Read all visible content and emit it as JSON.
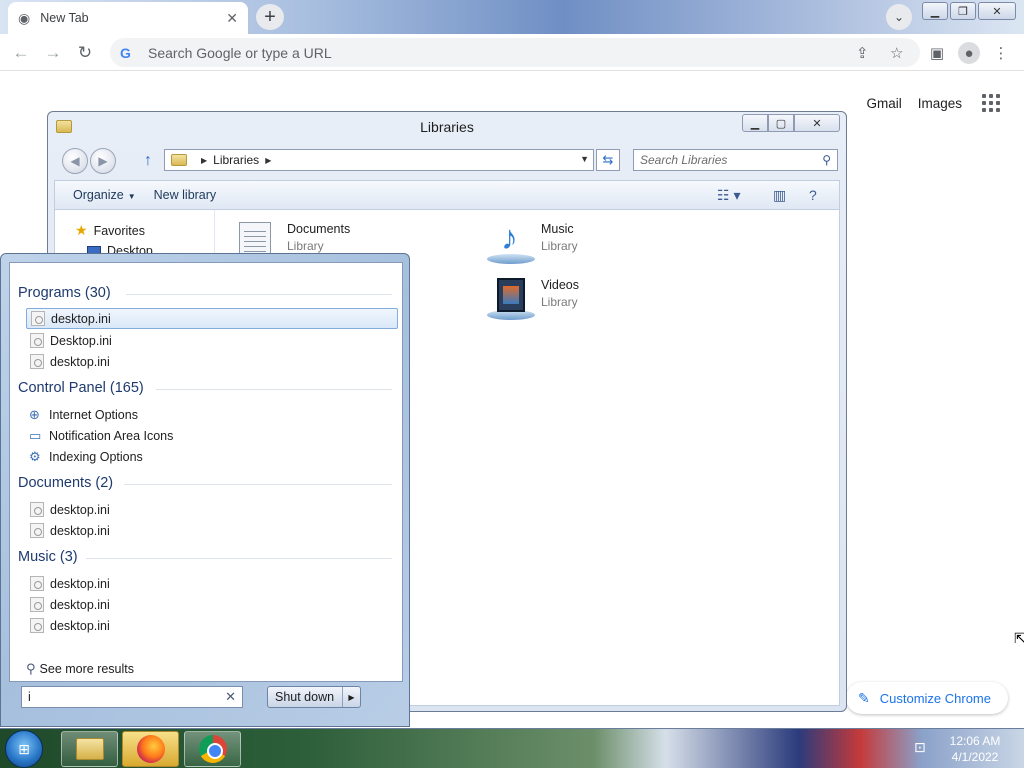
{
  "chrome": {
    "tab_title": "New Tab",
    "omnibox_placeholder": "Search Google or type a URL",
    "gmail": "Gmail",
    "images": "Images",
    "customize": "Customize Chrome"
  },
  "explorer": {
    "title": "Libraries",
    "breadcrumb": "Libraries",
    "search_placeholder": "Search Libraries",
    "commands": {
      "organize": "Organize",
      "new_library": "New library"
    },
    "nav": {
      "favorites": "Favorites",
      "desktop": "Desktop"
    },
    "libraries": [
      {
        "name": "Documents",
        "type": "Library"
      },
      {
        "name": "Music",
        "type": "Library"
      },
      {
        "name": "Videos",
        "type": "Library"
      }
    ]
  },
  "start_menu": {
    "groups": [
      {
        "header": "Programs (30)",
        "items": [
          "desktop.ini",
          "Desktop.ini",
          "desktop.ini"
        ]
      },
      {
        "header": "Control Panel (165)",
        "items": [
          "Internet Options",
          "Notification Area Icons",
          "Indexing Options"
        ]
      },
      {
        "header": "Documents (2)",
        "items": [
          "desktop.ini",
          "desktop.ini"
        ]
      },
      {
        "header": "Music (3)",
        "items": [
          "desktop.ini",
          "desktop.ini",
          "desktop.ini"
        ]
      }
    ],
    "see_more": "See more results",
    "search_value": "i",
    "shutdown": "Shut down"
  },
  "taskbar": {
    "time": "12:06 AM",
    "date": "4/1/2022"
  },
  "colors": {
    "chrome_accent": "#1a73e8",
    "start_group_header": "#1e3a6e"
  }
}
